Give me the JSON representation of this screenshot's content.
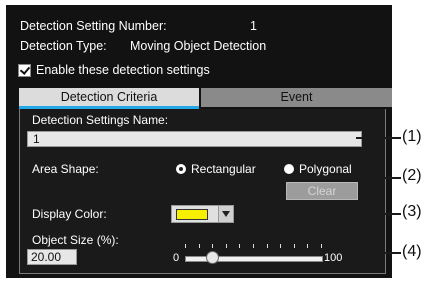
{
  "header": {
    "number_label": "Detection Setting Number:",
    "number_value": "1",
    "type_label": "Detection Type:",
    "type_value": "Moving Object Detection",
    "enable_label": "Enable these detection settings",
    "enable_checked": true
  },
  "tabs": [
    {
      "label": "Detection Criteria",
      "active": true
    },
    {
      "label": "Event",
      "active": false
    }
  ],
  "form": {
    "name_label": "Detection Settings Name:",
    "name_value": "1",
    "area_label": "Area Shape:",
    "area_options": [
      "Rectangular",
      "Polygonal"
    ],
    "area_selected": "Rectangular",
    "clear_label": "Clear",
    "color_label": "Display Color:",
    "color_value": "#f7ef00",
    "size_label": "Object Size (%):",
    "size_value": "20.00",
    "slider_min": "0",
    "slider_max": "100",
    "slider_fraction": 0.2
  },
  "callouts": [
    "(1)",
    "(2)",
    "(3)",
    "(4)"
  ],
  "icons": {
    "dropdown": "chevron-down-icon",
    "checkbox": "checkmark-icon"
  },
  "colors": {
    "panel": "#121212",
    "tab_accent": "#25a8e8",
    "swatch": "#f7ef00"
  }
}
